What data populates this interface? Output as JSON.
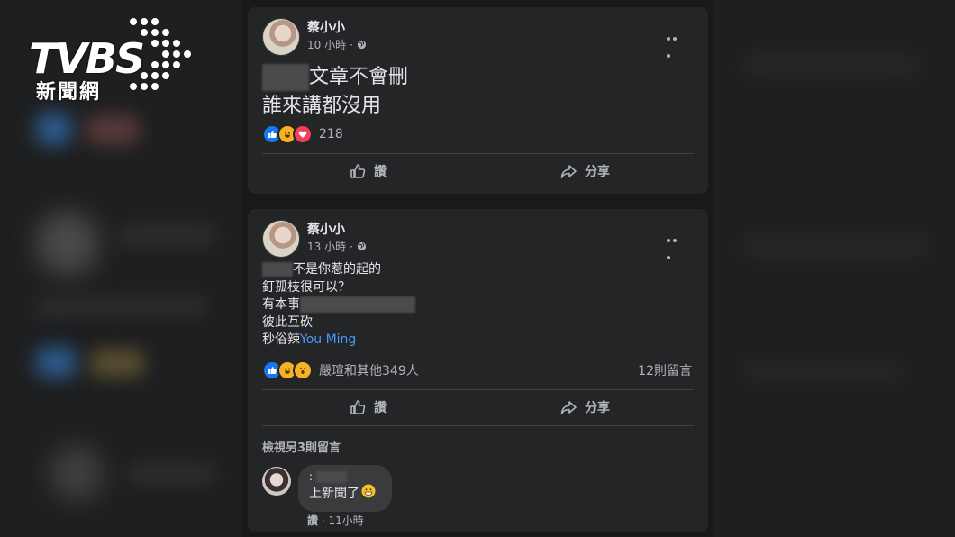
{
  "watermark": {
    "brand": "TVBS",
    "subtitle": "新聞網"
  },
  "posts": [
    {
      "author": "蔡小小",
      "time": "10 小時",
      "lines": [
        "文章不會刪",
        "誰來講都沒用"
      ],
      "reaction_count": "218",
      "actions": {
        "like": "讚",
        "share": "分享"
      }
    },
    {
      "author": "蔡小小",
      "time": "13 小時",
      "lines": [
        "不是你惹的起的",
        "釘孤枝很可以？",
        "有本事",
        "彼此互砍",
        "秒俗辣"
      ],
      "mention": "You Ming",
      "reaction_summary": "嚴瑄和其他349人",
      "comment_count": "12則留言",
      "actions": {
        "like": "讚",
        "share": "分享"
      },
      "view_more_comments": "檢視另3則留言",
      "comment": {
        "name_prefix": ":",
        "text": "上新聞了",
        "like_label": "讚",
        "time": "11小時"
      }
    }
  ],
  "icons": {
    "more": "more-options-icon",
    "globe": "globe-icon",
    "like": "thumbs-up-icon",
    "share": "share-arrow-icon"
  },
  "colors": {
    "background": "#18191a",
    "card": "#242526",
    "mention": "#4599ff",
    "muted": "#b0b3b8"
  }
}
